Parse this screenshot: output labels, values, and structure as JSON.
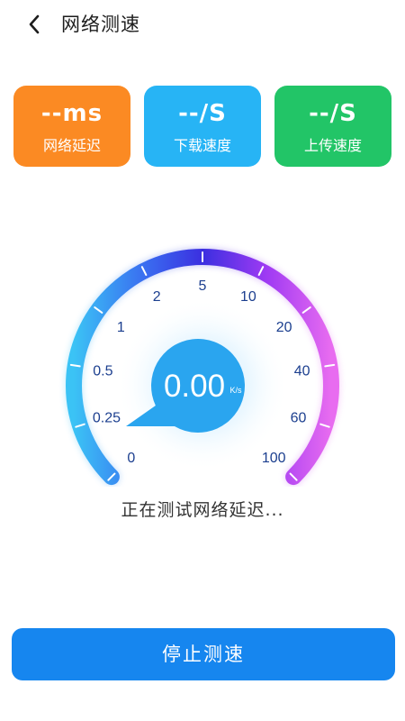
{
  "header": {
    "title": "网络测速",
    "back_icon": "chevron-left-icon"
  },
  "cards": [
    {
      "value": "--ms",
      "label": "网络延迟",
      "color": "#fb8a23"
    },
    {
      "value": "--/S",
      "label": "下载速度",
      "color": "#27b4f5"
    },
    {
      "value": "--/S",
      "label": "上传速度",
      "color": "#22c567"
    }
  ],
  "gauge": {
    "value": "0.00",
    "unit": "K/s",
    "tick_labels": [
      "0",
      "0.25",
      "0.5",
      "1",
      "2",
      "5",
      "10",
      "20",
      "40",
      "60",
      "100"
    ],
    "gradient_colors": [
      "#3bc3f5",
      "#3a6cf0",
      "#3b2fe0",
      "#9f3af3",
      "#e86cf0"
    ],
    "center_color": "#2aa5ef"
  },
  "status": {
    "text": "正在测试网络延迟..."
  },
  "actions": {
    "stop_label": "停止测速"
  }
}
